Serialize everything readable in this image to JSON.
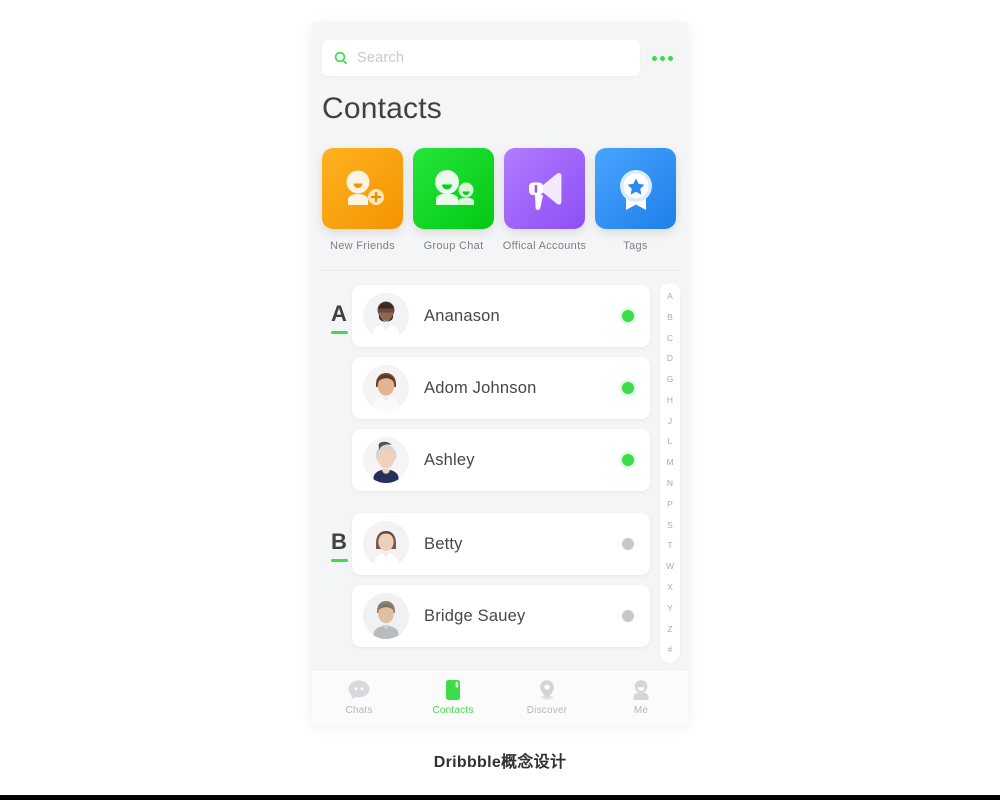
{
  "search": {
    "placeholder": "Search",
    "icon": "search-icon",
    "menu_icon": "more-dots-icon",
    "accent": "#3ddc4a"
  },
  "header": {
    "title": "Contacts"
  },
  "categories": [
    {
      "label": "New Friends",
      "icon": "add-friend-icon",
      "color": "#f5a200",
      "color2": "#ffb220"
    },
    {
      "label": "Group Chat",
      "icon": "group-chat-icon",
      "color": "#07d318",
      "color2": "#23e636"
    },
    {
      "label": "Offical Accounts",
      "icon": "megaphone-icon",
      "color": "#9b5cf6",
      "color2": "#b07cff"
    },
    {
      "label": "Tags",
      "icon": "tag-badge-star-icon",
      "color": "#2a8cf0",
      "color2": "#49a4ff"
    }
  ],
  "contact_groups": [
    {
      "letter": "A",
      "contacts": [
        {
          "name": "Ananason",
          "status": "online",
          "avatar": "avatar-man-beard"
        },
        {
          "name": "Adom Johnson",
          "status": "online",
          "avatar": "avatar-man-short-hair"
        },
        {
          "name": "Ashley",
          "status": "online",
          "avatar": "avatar-woman-blonde"
        }
      ]
    },
    {
      "letter": "B",
      "contacts": [
        {
          "name": "Betty",
          "status": "offline",
          "avatar": "avatar-woman-brown-hair"
        },
        {
          "name": "Bridge Sauey",
          "status": "offline",
          "avatar": "avatar-man-grey-shirt"
        }
      ]
    }
  ],
  "index_letters": [
    "A",
    "B",
    "C",
    "D",
    "G",
    "H",
    "J",
    "L",
    "M",
    "N",
    "P",
    "S",
    "T",
    "W",
    "X",
    "Y",
    "Z",
    "#"
  ],
  "tabs": [
    {
      "label": "Chats",
      "icon": "chat-bubble-icon",
      "active": false
    },
    {
      "label": "Contacts",
      "icon": "contacts-book-icon",
      "active": true
    },
    {
      "label": "Discover",
      "icon": "location-pin-icon",
      "active": false
    },
    {
      "label": "Me",
      "icon": "person-icon",
      "active": false
    }
  ],
  "status_colors": {
    "online": "#3ddc4a",
    "offline": "#c6c7cb"
  },
  "caption": {
    "text": "Dribbble概念设计"
  }
}
